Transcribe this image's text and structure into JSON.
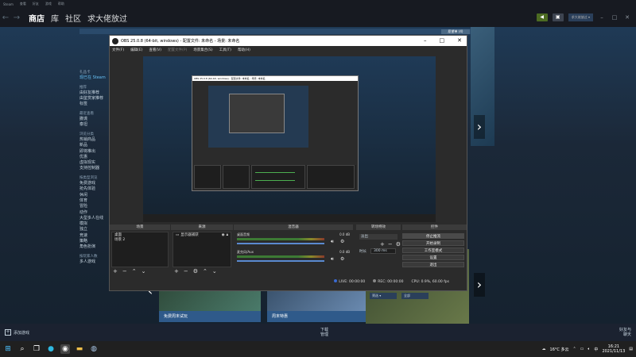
{
  "steam": {
    "menu": [
      "Steam",
      "查看",
      "好友",
      "游戏",
      "帮助"
    ],
    "nav": {
      "store": "商店",
      "library": "库",
      "community": "社区",
      "username": "求大佬放过"
    },
    "user_badge": "求大佬放过 ▾",
    "wishlist": "愿望单 (4)",
    "sidebar": {
      "gift_card": "礼品卡",
      "gift_card_sub": "现已在 Steam",
      "recommend_head": "推荐",
      "recommend_items": [
        "由好友推荐",
        "由鉴赏家推荐",
        "标签"
      ],
      "recent_head": "最近查看",
      "recent_items": [
        "撒谎",
        "泰坦"
      ],
      "browse_head": "浏览分类",
      "browse_items": [
        "热销商品",
        "新品",
        "即将推出",
        "优惠",
        "虚拟现实",
        "支持控制器"
      ],
      "category_head": "按类型浏览",
      "category_items": [
        "免费游戏",
        "抢先体验",
        "休闲",
        "体育",
        "冒险",
        "动作",
        "大型多人在线",
        "模拟",
        "独立",
        "竞速",
        "策略",
        "角色扮演"
      ],
      "players_head": "按玩家人数",
      "players_items": [
        "多人游戏"
      ]
    },
    "promo_free": "免费周末试玩",
    "promo_weekend": "周末特惠",
    "select1": "筛选 ▾",
    "select2": "全部",
    "add_game": "添加游戏",
    "downloads_label": "下载",
    "downloads_sub": "管理",
    "friends_label": "好友与",
    "friends_sub": "聊天"
  },
  "obs": {
    "title": "OBS 25.0.8 (64-bit, windows) - 配置文件: 未命名 - 场景: 未命名",
    "menu": [
      "文件(F)",
      "编辑(E)",
      "查看(V)",
      "配置文件(P)",
      "场景集合(S)",
      "工具(T)",
      "帮助(H)"
    ],
    "docks": {
      "scenes": {
        "header": "场景",
        "items": [
          "桌面",
          "场景 2"
        ]
      },
      "sources": {
        "header": "来源",
        "items": [
          "显示器捕获"
        ]
      },
      "mixer": {
        "header": "混音器",
        "channels": [
          {
            "name": "桌面音频",
            "db": "0.0 dB"
          },
          {
            "name": "麦克风/Aux",
            "db": "0.0 dB"
          }
        ]
      },
      "transitions": {
        "header": "转场特效",
        "type": "淡出",
        "duration_label": "时长",
        "duration_value": "300 ms"
      },
      "controls": {
        "header": "控件",
        "buttons": [
          "停止推流",
          "开始录制",
          "工作室模式",
          "设置",
          "退出"
        ]
      }
    },
    "status": {
      "live": "LIVE: 00:00:00",
      "rec": "REC: 00:00:00",
      "cpu": "CPU: 0.9%, 60.00 fps"
    }
  },
  "taskbar": {
    "weather": "16°C 多云",
    "ime": "中",
    "time": "16:21",
    "date": "2021/11/13"
  }
}
